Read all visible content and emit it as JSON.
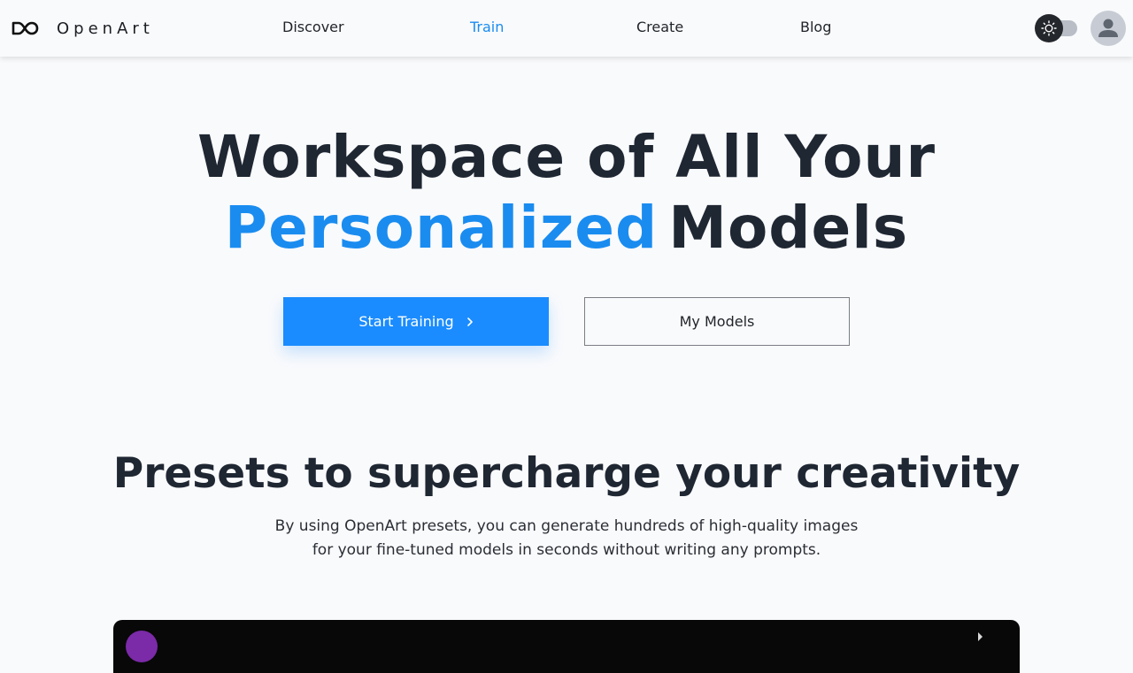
{
  "brand": {
    "name": "OpenArt",
    "logo_icon": "infinity-icon"
  },
  "nav": {
    "items": [
      {
        "label": "Discover",
        "active": false
      },
      {
        "label": "Train",
        "active": true
      },
      {
        "label": "Create",
        "active": false
      },
      {
        "label": "Blog",
        "active": false
      }
    ]
  },
  "header_controls": {
    "theme_toggle_icon": "sun-icon",
    "theme_mode": "light",
    "avatar_icon": "user-icon"
  },
  "hero": {
    "title_line1": "Workspace of All Your",
    "title_accent": "Personalized",
    "title_line2_rest": "Models",
    "primary_button": "Start Training",
    "primary_button_icon": "chevron-right-icon",
    "secondary_button": "My Models"
  },
  "presets": {
    "title": "Presets to supercharge your creativity",
    "description_line1": "By using OpenArt presets, you can generate hundreds of high-quality images",
    "description_line2": "for your fine-tuned models in seconds without writing any prompts."
  },
  "colors": {
    "accent": "#1a8cf0",
    "button_primary": "#1a8cff",
    "text_dark": "#1f2733",
    "background": "#f9fafc",
    "panel_dark": "#080808",
    "preset_avatar": "#7b2aa8"
  }
}
